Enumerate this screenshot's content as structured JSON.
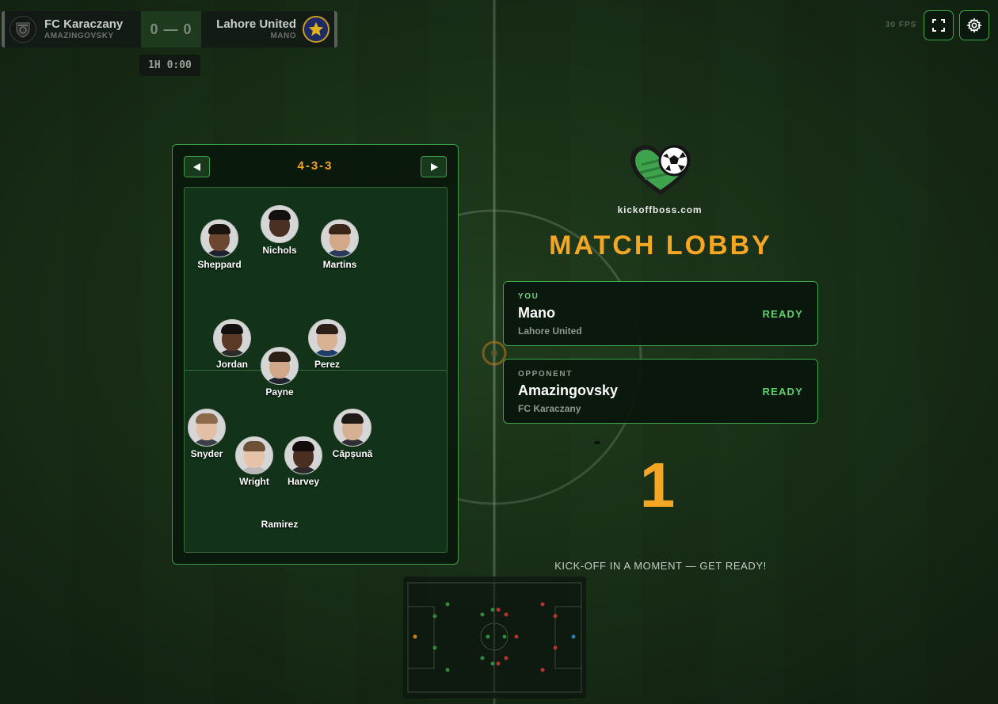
{
  "scoreboard": {
    "home": {
      "name": "FC Karaczany",
      "manager": "AMAZINGOVSKY",
      "crest_icon": "karaczany-crest-icon"
    },
    "away": {
      "name": "Lahore United",
      "manager": "MANO",
      "crest_icon": "star-crest-icon"
    },
    "score": "0 — 0",
    "clock": "1H 0:00"
  },
  "hud": {
    "fps": "30 FPS",
    "fullscreen_icon": "fullscreen-icon",
    "settings_icon": "gear-icon"
  },
  "formation": {
    "label": "4-3-3",
    "prev_icon": "left-arrow-icon",
    "next_icon": "right-arrow-icon",
    "players": [
      {
        "name": "Sheppard",
        "skin": "#6b4630",
        "hair": "#1b130e",
        "shirt": "#1e2130"
      },
      {
        "name": "Nichols",
        "skin": "#4a3022",
        "hair": "#151010",
        "shirt": "#d9d9d9"
      },
      {
        "name": "Martins",
        "skin": "#d3a98a",
        "hair": "#3a2619",
        "shirt": "#2b3a5a"
      },
      {
        "name": "Jordan",
        "skin": "#5a3a26",
        "hair": "#151010",
        "shirt": "#2b2b2b"
      },
      {
        "name": "Perez",
        "skin": "#d8b195",
        "hair": "#2a1e16",
        "shirt": "#1f3c6a"
      },
      {
        "name": "Payne",
        "skin": "#d2a88b",
        "hair": "#2b1f16",
        "shirt": "#1f2430"
      },
      {
        "name": "Snyder",
        "skin": "#e3bfa5",
        "hair": "#8a6a4a",
        "shirt": "#3a3f4a"
      },
      {
        "name": "Căpșună",
        "skin": "#d6b092",
        "hair": "#1f1a16",
        "shirt": "#2e2e35"
      },
      {
        "name": "Wright",
        "skin": "#e6c2a8",
        "hair": "#6d5038",
        "shirt": "#b8b8b8"
      },
      {
        "name": "Harvey",
        "skin": "#4a2f22",
        "hair": "#120d0b",
        "shirt": "#2a2a2a"
      },
      {
        "name": "Ramirez"
      }
    ]
  },
  "lobby": {
    "site": "kickoffboss.com",
    "logo_icon": "heart-football-logo-icon",
    "title": "MATCH LOBBY",
    "you": {
      "role": "YOU",
      "name": "Mano",
      "team": "Lahore United",
      "status": "READY"
    },
    "opponent": {
      "role": "OPPONENT",
      "name": "Amazingovsky",
      "team": "FC Karaczany",
      "status": "READY"
    },
    "countdown": "1",
    "message": "KICK-OFF IN A MOMENT — GET READY!"
  },
  "colors": {
    "accent": "#f5a623",
    "border": "#3da649",
    "ready": "#5fcf6c",
    "home_dot": "#2e8a3c",
    "away_dot": "#b8322c"
  }
}
